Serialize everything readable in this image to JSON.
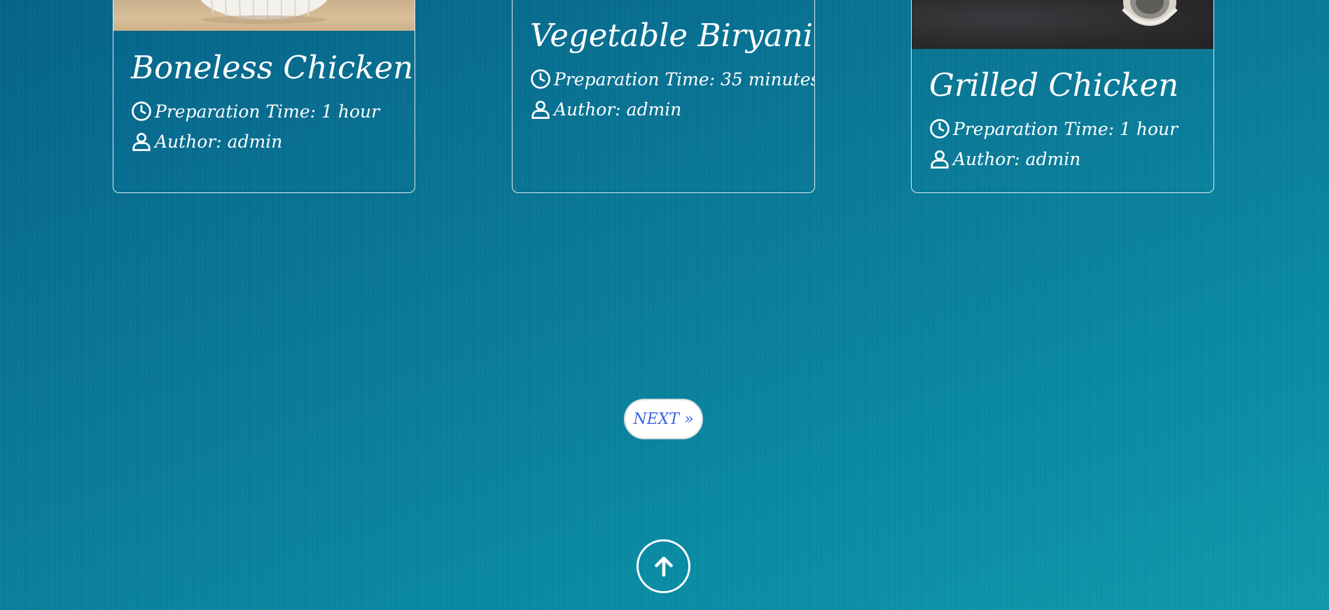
{
  "recipes": [
    {
      "title": "Boneless Chicken",
      "image": "white-ramekin-on-wood-photo",
      "prep_time": "Preparation Time: 1 hour",
      "author": "Author: admin"
    },
    {
      "title": "Vegetable Biryani",
      "prep_time": "Preparation Time: 35 minutes",
      "author": "Author: admin"
    },
    {
      "title": "Grilled Chicken",
      "image": "grill-pan-on-dark-surface-photo",
      "prep_time": "Preparation Time: 1 hour",
      "author": "Author: admin"
    }
  ],
  "pagination": {
    "next_label": "NEXT »"
  },
  "scroll_top": {
    "icon": "arrow-up-icon"
  },
  "colors": {
    "background": "#0a7a98",
    "card_border": "#ffffff",
    "next_text": "#3c66e0",
    "text": "#ffffff"
  }
}
